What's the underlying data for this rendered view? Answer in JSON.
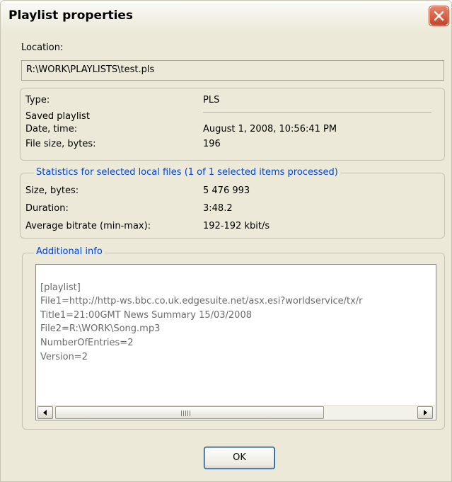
{
  "window": {
    "title": "Playlist properties"
  },
  "location": {
    "label": "Location:",
    "value": "R:\\WORK\\PLAYLISTS\\test.pls"
  },
  "file_info": {
    "type_label": "Type:",
    "type_value": "PLS",
    "saved_label": "Saved playlist",
    "date_label": "Date, time:",
    "date_value": "August 1, 2008, 10:56:41 PM",
    "size_label": "File size, bytes:",
    "size_value": "196"
  },
  "statistics": {
    "legend": "Statistics for selected local files (1 of 1 selected items processed)",
    "size_label": "Size, bytes:",
    "size_value": "5 476 993",
    "duration_label": "Duration:",
    "duration_value": "3:48.2",
    "bitrate_label": "Average bitrate (min-max):",
    "bitrate_value": "192-192 kbit/s"
  },
  "additional": {
    "legend": "Additional info",
    "lines": [
      "[playlist]",
      "File1=http://http-ws.bbc.co.uk.edgesuite.net/asx.esi?worldservice/tx/r",
      "Title1=21:00GMT News Summary 15/03/2008",
      "File2=R:\\WORK\\Song.mp3",
      "NumberOfEntries=2",
      "Version=2"
    ]
  },
  "buttons": {
    "ok": "OK"
  },
  "icons": {
    "close": "close-icon",
    "scroll_left": "arrow-left-icon",
    "scroll_right": "arrow-right-icon",
    "thumb": "grip-icon"
  },
  "colors": {
    "legend": "#0046d5",
    "close_button": "#c3432a",
    "dialog_bg": "#ece9d8"
  }
}
